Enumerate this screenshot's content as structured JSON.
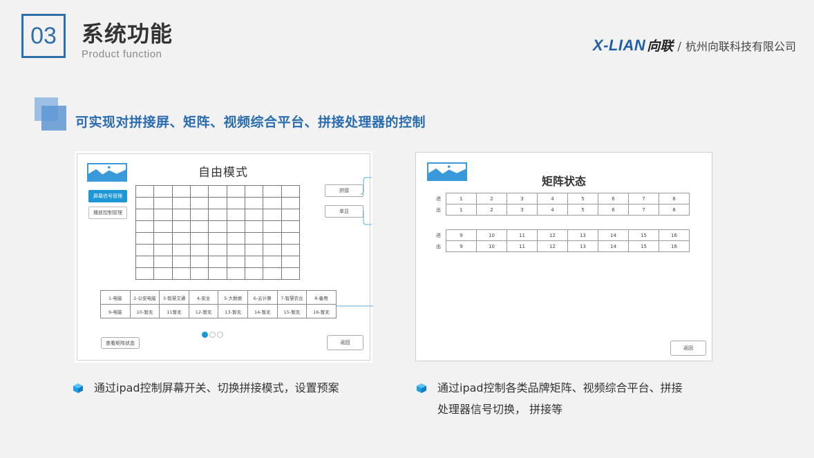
{
  "header": {
    "number": "03",
    "title_cn": "系统功能",
    "title_en": "Product  function",
    "brand_logo": "X-LIAN",
    "brand_cn": "向联",
    "brand_sep": "/",
    "company": "杭州向联科技有限公司"
  },
  "section": {
    "title": "可实现对拼接屏、矩阵、视频综合平台、拼接处理器的控制"
  },
  "left_panel": {
    "mode_title": "自由模式",
    "btn_blue": "屏幕信号管理",
    "btn_white": "播放控制管理",
    "side_btn_1": "拼接",
    "side_btn_2": "单显",
    "mode_rows": [
      [
        "1-电脑",
        "2-公安电脑",
        "3-智慧交通",
        "4-安全",
        "5-大数据",
        "6-云计算",
        "7-智慧农业",
        "8-备用"
      ],
      [
        "9-电脑",
        "10-暂无",
        "11暂无",
        "12-暂无",
        "13-暂无",
        "14-暂无",
        "15-暂无",
        "16-暂无"
      ]
    ],
    "btn_matrix_view": "查看矩阵状态",
    "btn_back": "返回"
  },
  "right_panel": {
    "title": "矩阵状态",
    "in_label": "进",
    "out_label": "出",
    "group1": [
      "1",
      "2",
      "3",
      "4",
      "5",
      "6",
      "7",
      "8"
    ],
    "group2": [
      "9",
      "10",
      "11",
      "12",
      "13",
      "14",
      "15",
      "16"
    ],
    "btn_back": "返回"
  },
  "captions": {
    "left": "通过ipad控制屏幕开关、切换拼接模式，设置预案",
    "right_line1": "通过ipad控制各类品牌矩阵、视频综合平台、拼接",
    "right_line2": "处理器信号切换，  拼接等"
  },
  "colors": {
    "accent": "#2f6ea6",
    "section_title": "#2a6cb0",
    "button_blue": "#1e97d6",
    "icon_blue": "#1e9ee6"
  }
}
